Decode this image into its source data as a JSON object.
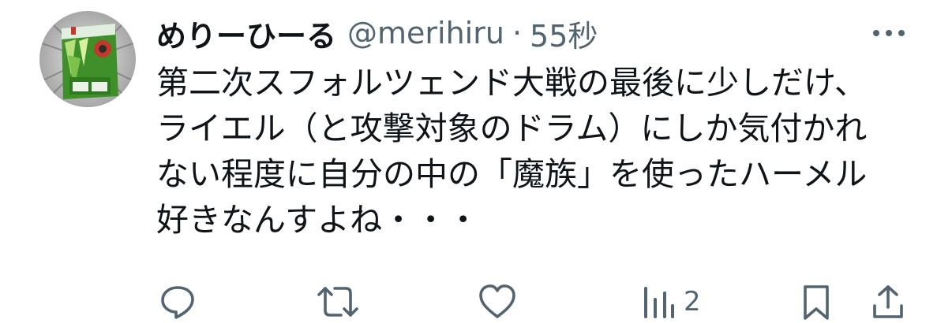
{
  "author": {
    "display_name": "めりーひーる",
    "handle": "@merihiru",
    "separator": "·",
    "time_ago": "55秒",
    "avatar_icon": "matcha-tea-pack-avatar"
  },
  "tweet": {
    "lines": [
      "第二次スフォルツェンド大戦の最後に少しだけ、",
      "ライエル（と攻撃対象のドラム）にしか気付かれ",
      "ない程度に自分の中の「魔族」を使ったハーメル",
      "好きなんすよね・・・"
    ]
  },
  "actions": {
    "reply_icon": "reply-icon",
    "retweet_icon": "retweet-icon",
    "like_icon": "like-icon",
    "views_icon": "views-icon",
    "views_count": "2",
    "bookmark_icon": "bookmark-icon",
    "share_icon": "share-icon"
  },
  "colors": {
    "text_primary": "#0f1419",
    "text_secondary": "#536471",
    "icon": "#536471"
  }
}
